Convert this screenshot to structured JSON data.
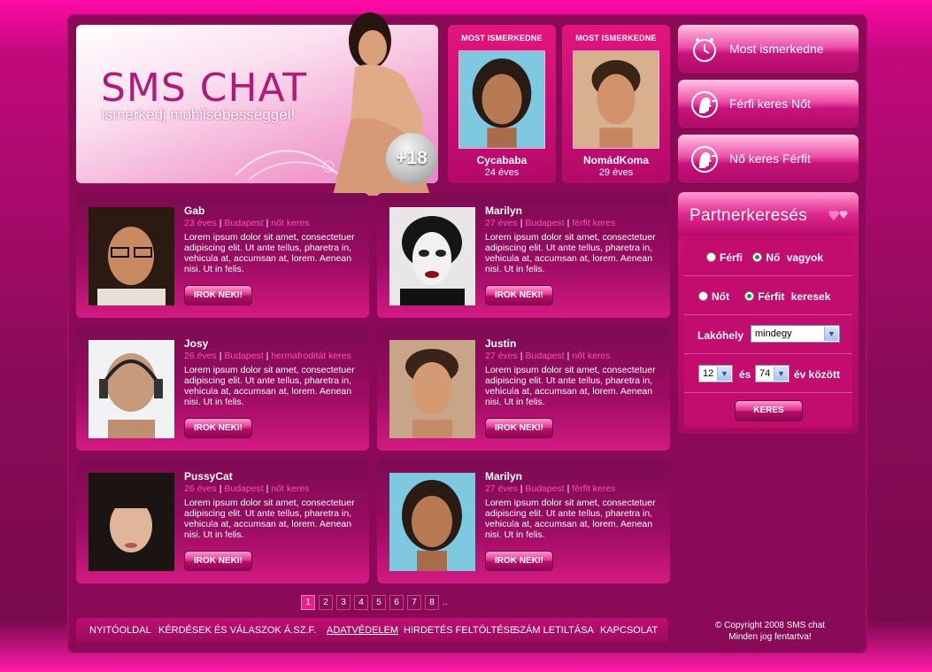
{
  "banner": {
    "title": "SMS CHAT",
    "subtitle": "Ismerkedj mobilsebességgel!",
    "age_badge": "+18"
  },
  "featured": [
    {
      "header": "MOST ISMERKEDNE",
      "name": "Cycababa",
      "age": "24 éves"
    },
    {
      "header": "MOST ISMERKEDNE",
      "name": "NomádKoma",
      "age": "29 éves"
    }
  ],
  "menu": [
    {
      "label": "Most ismerkedne",
      "icon": "clock-icon"
    },
    {
      "label": "Férfi keres Nőt",
      "icon": "profile-head-icon"
    },
    {
      "label": "Nő keres Férfit",
      "icon": "profile-head-icon"
    }
  ],
  "search": {
    "title": "Partnerkeresés",
    "gender_opts": [
      "Férfi",
      "Nő"
    ],
    "gender_suffix": "vagyok",
    "seek_opts": [
      "Nőt",
      "Férfit"
    ],
    "seek_suffix": "keresek",
    "location_label": "Lakóhely",
    "location_value": "mindegy",
    "age_from": "12",
    "age_and": "és",
    "age_to": "74",
    "age_suffix": "év között",
    "submit": "KERES"
  },
  "profiles": [
    {
      "name": "Gab",
      "age": "23 éves",
      "city": "Budapest",
      "seeks": "nőt keres",
      "button": "IROK NEKI!"
    },
    {
      "name": "Marilyn",
      "age": "27 éves",
      "city": "Budapest",
      "seeks": "férfit keres",
      "button": "IROK NEKI!"
    },
    {
      "name": "Josy",
      "age": "26 éves",
      "city": "Budapest",
      "seeks": "hermafroditát keres",
      "button": "IROK NEKI!"
    },
    {
      "name": "Justin",
      "age": "27 éves",
      "city": "Budapest",
      "seeks": "nőt keres",
      "button": "IROK NEKI!"
    },
    {
      "name": "PussyCat",
      "age": "26 éves",
      "city": "Budapest",
      "seeks": "nőt keres",
      "button": "IROK NEKI!"
    },
    {
      "name": "Marilyn",
      "age": "27 éves",
      "city": "Budapest",
      "seeks": "férfit keres",
      "button": "IROK NEKI!"
    }
  ],
  "lorem": "Lorem ipsum dolor sit amet, consectetuer adipiscing elit. Ut ante tellus, pharetra in, vehicula at, accumsan at, lorem. Aenean nisi. Ut in felis.",
  "meta_sep": "|",
  "pagination": {
    "pages": [
      "1",
      "2",
      "3",
      "4",
      "5",
      "6",
      "7",
      "8"
    ],
    "more": "..",
    "active": "1"
  },
  "footer": {
    "nav": [
      "NYITÓOLDAL",
      "KÉRDÉSEK ÉS VÁLASZOK",
      "Á.SZ.F.",
      "ADATVÉDELEM",
      "HIRDETÉS FELTÖLTÉSE",
      "SZÁM LETILTÁSA",
      "KAPCSOLAT"
    ],
    "copyright_1": "© Copyright 2008 SMS chat",
    "copyright_2": "Minden jog fentartva!"
  },
  "colors": {
    "brand_pink": "#e6157f",
    "accent_link": "#ff4fb5",
    "panel_dark": "#8a0a57"
  }
}
